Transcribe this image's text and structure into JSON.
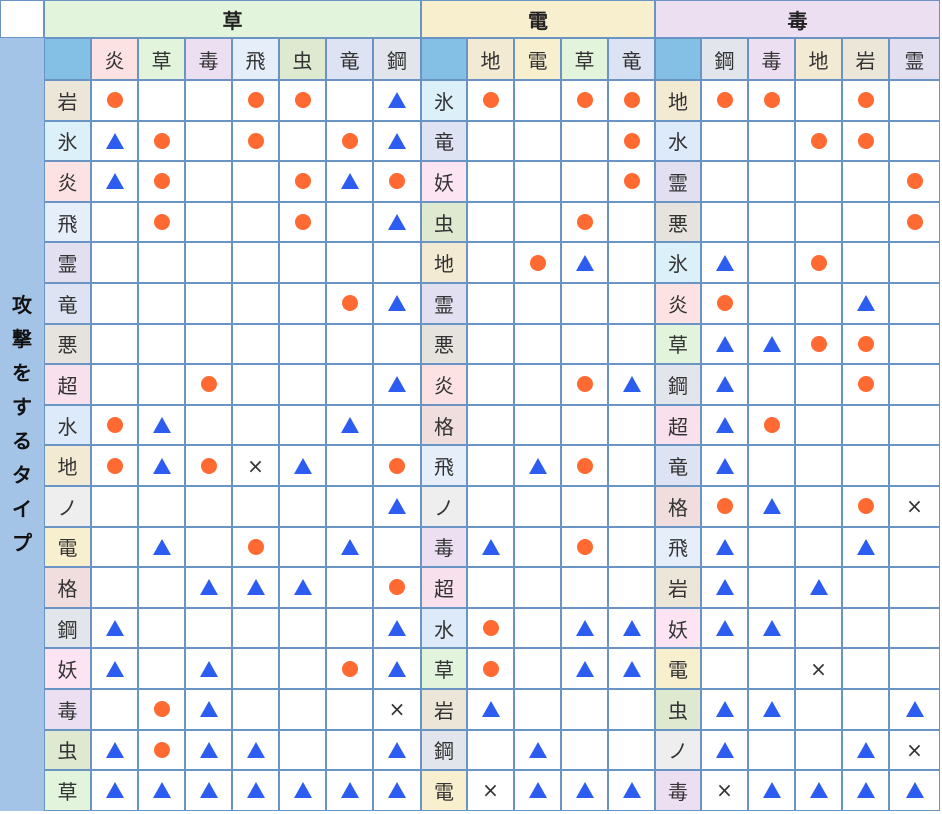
{
  "symbols": {
    "dot": "●",
    "triangle": "▲",
    "cross": "×"
  },
  "colors": {
    "grid_border": "#6a94c4",
    "header_blue": "#84bfe5",
    "side": "#a3c4e6",
    "dot": "#ff6a33",
    "triangle": "#2d5cf0"
  },
  "type_colors": {
    "炎": "#fce2e2",
    "草": "#e2f4dc",
    "毒": "#ecdff2",
    "飛": "#e6eefa",
    "虫": "#dfe9d0",
    "竜": "#dde3f3",
    "鋼": "#e2e6ec",
    "地": "#f3ead4",
    "電": "#f8efcf",
    "岩": "#ece6d8",
    "霊": "#e2e0f0",
    "氷": "#dbf0f8",
    "水": "#dceafa",
    "悪": "#e6e2de",
    "超": "#f8e0ec",
    "ノ": "#eeeeee",
    "格": "#f0dede",
    "妖": "#fce4f2"
  },
  "side_label": [
    "攻",
    "撃",
    "を",
    "す",
    "る",
    "タ",
    "イ",
    "プ"
  ],
  "sections": [
    {
      "title": "草",
      "title_bg": "#e2f4dc",
      "defending": [
        "炎",
        "草",
        "毒",
        "飛",
        "虫",
        "竜",
        "鋼"
      ],
      "rows": [
        {
          "attacker": "岩",
          "marks": [
            "o",
            "",
            "",
            "o",
            "o",
            "",
            "t"
          ]
        },
        {
          "attacker": "氷",
          "marks": [
            "t",
            "o",
            "",
            "o",
            "",
            "o",
            "t"
          ]
        },
        {
          "attacker": "炎",
          "marks": [
            "t",
            "o",
            "",
            "",
            "o",
            "t",
            "o"
          ]
        },
        {
          "attacker": "飛",
          "marks": [
            "",
            "o",
            "",
            "",
            "o",
            "",
            "t"
          ]
        },
        {
          "attacker": "霊",
          "marks": [
            "",
            "",
            "",
            "",
            "",
            "",
            ""
          ]
        },
        {
          "attacker": "竜",
          "marks": [
            "",
            "",
            "",
            "",
            "",
            "o",
            "t"
          ]
        },
        {
          "attacker": "悪",
          "marks": [
            "",
            "",
            "",
            "",
            "",
            "",
            ""
          ]
        },
        {
          "attacker": "超",
          "marks": [
            "",
            "",
            "o",
            "",
            "",
            "",
            "t"
          ]
        },
        {
          "attacker": "水",
          "marks": [
            "o",
            "t",
            "",
            "",
            "",
            "t",
            ""
          ]
        },
        {
          "attacker": "地",
          "marks": [
            "o",
            "t",
            "o",
            "x",
            "t",
            "",
            "o"
          ]
        },
        {
          "attacker": "ノ",
          "marks": [
            "",
            "",
            "",
            "",
            "",
            "",
            "t"
          ]
        },
        {
          "attacker": "電",
          "marks": [
            "",
            "t",
            "",
            "o",
            "",
            "t",
            ""
          ]
        },
        {
          "attacker": "格",
          "marks": [
            "",
            "",
            "t",
            "t",
            "t",
            "",
            "o"
          ]
        },
        {
          "attacker": "鋼",
          "marks": [
            "t",
            "",
            "",
            "",
            "",
            "",
            "t"
          ]
        },
        {
          "attacker": "妖",
          "marks": [
            "t",
            "",
            "t",
            "",
            "",
            "o",
            "t"
          ]
        },
        {
          "attacker": "毒",
          "marks": [
            "",
            "o",
            "t",
            "",
            "",
            "",
            "x"
          ]
        },
        {
          "attacker": "虫",
          "marks": [
            "t",
            "o",
            "t",
            "t",
            "",
            "",
            "t"
          ]
        },
        {
          "attacker": "草",
          "marks": [
            "t",
            "t",
            "t",
            "t",
            "t",
            "t",
            "t"
          ]
        }
      ]
    },
    {
      "title": "電",
      "title_bg": "#f8efcf",
      "defending": [
        "地",
        "電",
        "草",
        "竜"
      ],
      "rows": [
        {
          "attacker": "氷",
          "marks": [
            "o",
            "",
            "o",
            "o"
          ]
        },
        {
          "attacker": "竜",
          "marks": [
            "",
            "",
            "",
            "o"
          ]
        },
        {
          "attacker": "妖",
          "marks": [
            "",
            "",
            "",
            "o"
          ]
        },
        {
          "attacker": "虫",
          "marks": [
            "",
            "",
            "o",
            ""
          ]
        },
        {
          "attacker": "地",
          "marks": [
            "",
            "o",
            "t",
            ""
          ]
        },
        {
          "attacker": "霊",
          "marks": [
            "",
            "",
            "",
            ""
          ]
        },
        {
          "attacker": "悪",
          "marks": [
            "",
            "",
            "",
            ""
          ]
        },
        {
          "attacker": "炎",
          "marks": [
            "",
            "",
            "o",
            "t"
          ]
        },
        {
          "attacker": "格",
          "marks": [
            "",
            "",
            "",
            ""
          ]
        },
        {
          "attacker": "飛",
          "marks": [
            "",
            "t",
            "o",
            ""
          ]
        },
        {
          "attacker": "ノ",
          "marks": [
            "",
            "",
            "",
            ""
          ]
        },
        {
          "attacker": "毒",
          "marks": [
            "t",
            "",
            "o",
            ""
          ]
        },
        {
          "attacker": "超",
          "marks": [
            "",
            "",
            "",
            ""
          ]
        },
        {
          "attacker": "水",
          "marks": [
            "o",
            "",
            "t",
            "t"
          ]
        },
        {
          "attacker": "草",
          "marks": [
            "o",
            "",
            "t",
            "t"
          ]
        },
        {
          "attacker": "岩",
          "marks": [
            "t",
            "",
            "",
            ""
          ]
        },
        {
          "attacker": "鋼",
          "marks": [
            "",
            "t",
            "",
            ""
          ]
        },
        {
          "attacker": "電",
          "marks": [
            "x",
            "t",
            "t",
            "t"
          ]
        }
      ]
    },
    {
      "title": "毒",
      "title_bg": "#ecdff2",
      "defending": [
        "鋼",
        "毒",
        "地",
        "岩",
        "霊"
      ],
      "rows": [
        {
          "attacker": "地",
          "marks": [
            "o",
            "o",
            "",
            "o",
            ""
          ]
        },
        {
          "attacker": "水",
          "marks": [
            "",
            "",
            "o",
            "o",
            ""
          ]
        },
        {
          "attacker": "霊",
          "marks": [
            "",
            "",
            "",
            "",
            "o"
          ]
        },
        {
          "attacker": "悪",
          "marks": [
            "",
            "",
            "",
            "",
            "o"
          ]
        },
        {
          "attacker": "氷",
          "marks": [
            "t",
            "",
            "o",
            "",
            ""
          ]
        },
        {
          "attacker": "炎",
          "marks": [
            "o",
            "",
            "",
            "t",
            ""
          ]
        },
        {
          "attacker": "草",
          "marks": [
            "t",
            "t",
            "o",
            "o",
            ""
          ]
        },
        {
          "attacker": "鋼",
          "marks": [
            "t",
            "",
            "",
            "o",
            ""
          ]
        },
        {
          "attacker": "超",
          "marks": [
            "t",
            "o",
            "",
            "",
            ""
          ]
        },
        {
          "attacker": "竜",
          "marks": [
            "t",
            "",
            "",
            "",
            ""
          ]
        },
        {
          "attacker": "格",
          "marks": [
            "o",
            "t",
            "",
            "o",
            "x"
          ]
        },
        {
          "attacker": "飛",
          "marks": [
            "t",
            "",
            "",
            "t",
            ""
          ]
        },
        {
          "attacker": "岩",
          "marks": [
            "t",
            "",
            "t",
            "",
            ""
          ]
        },
        {
          "attacker": "妖",
          "marks": [
            "t",
            "t",
            "",
            "",
            ""
          ]
        },
        {
          "attacker": "電",
          "marks": [
            "",
            "",
            "x",
            "",
            ""
          ]
        },
        {
          "attacker": "虫",
          "marks": [
            "t",
            "t",
            "",
            "",
            "t"
          ]
        },
        {
          "attacker": "ノ",
          "marks": [
            "t",
            "",
            "",
            "t",
            "x"
          ]
        },
        {
          "attacker": "毒",
          "marks": [
            "x",
            "t",
            "t",
            "t",
            "t"
          ]
        }
      ]
    }
  ]
}
